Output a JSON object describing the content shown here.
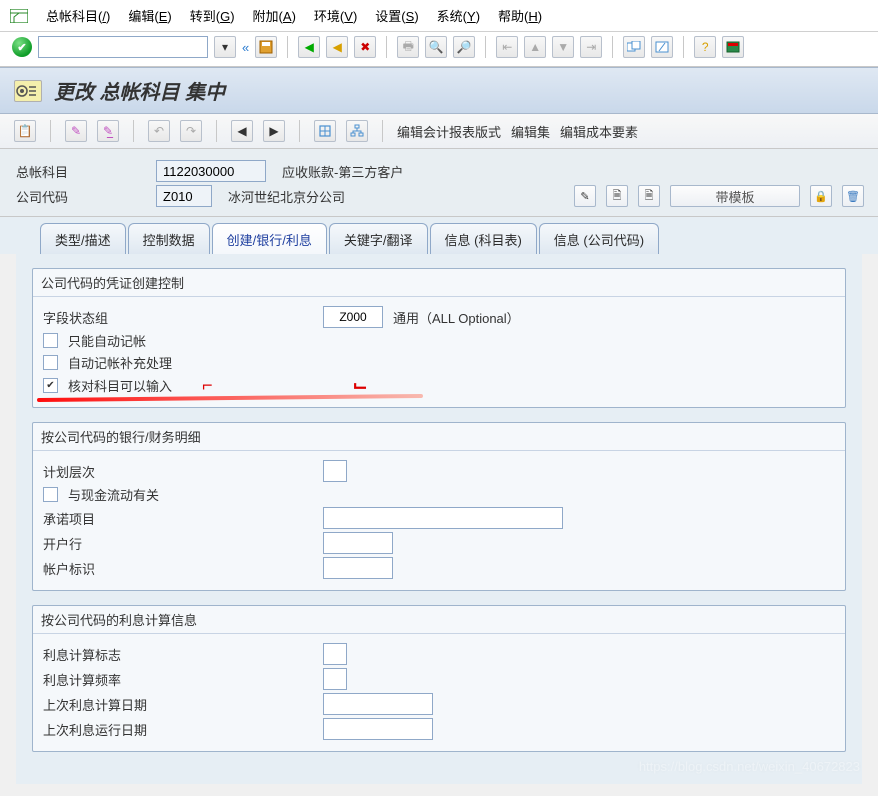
{
  "menu": {
    "items": [
      {
        "label": "总帐科目",
        "accel": "/"
      },
      {
        "label": "编辑",
        "accel": "E"
      },
      {
        "label": "转到",
        "accel": "G"
      },
      {
        "label": "附加",
        "accel": "A"
      },
      {
        "label": "环境",
        "accel": "V"
      },
      {
        "label": "设置",
        "accel": "S"
      },
      {
        "label": "系统",
        "accel": "Y"
      },
      {
        "label": "帮助",
        "accel": "H"
      }
    ]
  },
  "toolbar": {
    "back_hint": "«",
    "cmd_value": "",
    "icons": [
      "save",
      "back",
      "forward",
      "cancel",
      "stop",
      "print",
      "find",
      "findnext",
      "first",
      "prev",
      "next",
      "last",
      "session",
      "shortcut",
      "help",
      "layout"
    ]
  },
  "title": "更改 总帐科目 集中",
  "action_toolbar": {
    "links": [
      "编辑会计报表版式",
      "编辑集",
      "编辑成本要素"
    ]
  },
  "header": {
    "acct_label": "总帐科目",
    "acct_value": "1122030000",
    "acct_desc": "应收账款-第三方客户",
    "cc_label": "公司代码",
    "cc_value": "Z010",
    "cc_desc": "冰河世纪北京分公司",
    "template_label": "带模板"
  },
  "tabs": [
    "类型/描述",
    "控制数据",
    "创建/银行/利息",
    "关键字/翻译",
    "信息 (科目表)",
    "信息 (公司代码)"
  ],
  "active_tab_index": 2,
  "group1": {
    "title": "公司代码的凭证创建控制",
    "field_status_label": "字段状态组",
    "field_status_value": "Z000",
    "field_status_desc": "通用（ALL Optional）",
    "chk_post_auto_label": "只能自动记帐",
    "chk_post_auto": false,
    "chk_supp_label": "自动记帐补充处理",
    "chk_supp": false,
    "chk_recon_label": "核对科目可以输入",
    "chk_recon": true
  },
  "group2": {
    "title": "按公司代码的银行/财务明细",
    "plan_level_label": "计划层次",
    "plan_level_value": "",
    "chk_cash_label": "与现金流动有关",
    "chk_cash": false,
    "commitment_label": "承诺项目",
    "commitment_value": "",
    "housebank_label": "开户行",
    "housebank_value": "",
    "acctid_label": "帐户标识",
    "acctid_value": ""
  },
  "group3": {
    "title": "按公司代码的利息计算信息",
    "int_ind_label": "利息计算标志",
    "int_ind_value": "",
    "int_freq_label": "利息计算频率",
    "int_freq_value": "",
    "last_int_calc_label": "上次利息计算日期",
    "last_int_calc_value": "",
    "last_int_run_label": "上次利息运行日期",
    "last_int_run_value": ""
  },
  "watermark": "https://blog.csdn.net/weixin_40672823"
}
